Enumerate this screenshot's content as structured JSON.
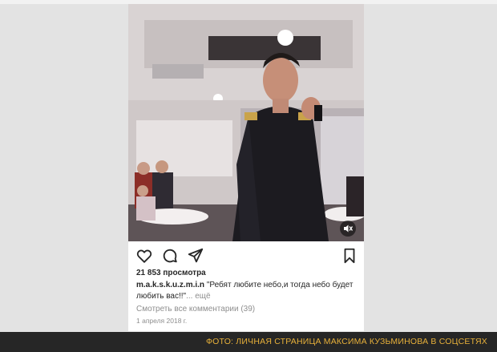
{
  "post": {
    "views": "21 853 просмотра",
    "username": "m.a.k.s.k.u.z.m.i.n",
    "caption": "\"Ребят любите небо,и тогда небо будет любить вас!!\"",
    "more": "... ещё",
    "comments_link": "Смотреть все комментарии (39)",
    "date": "1 апреля 2018 г."
  },
  "icons": [
    "heart-icon",
    "comment-icon",
    "share-icon",
    "bookmark-icon",
    "mute-icon"
  ],
  "footer": {
    "credit": "ФОТО: ЛИЧНАЯ СТРАНИЦА МАКСИМА КУЗЬМИНОВА В СОЦСЕТЯХ"
  },
  "colors": {
    "page_bg": "#e3e3e3",
    "footer_bg": "#262626",
    "footer_text": "#e8b13a",
    "muted_text": "#8e8e8e"
  }
}
